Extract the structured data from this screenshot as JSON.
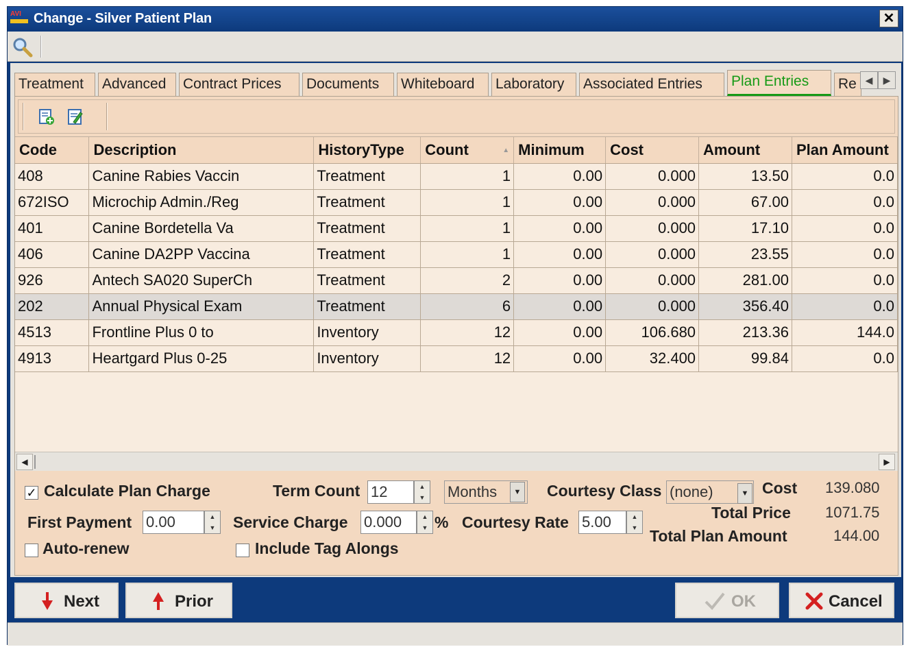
{
  "window": {
    "title": "Change - Silver Patient Plan",
    "logo_text": "AVI",
    "close_glyph": "✕"
  },
  "tabs": [
    {
      "label": "Treatment"
    },
    {
      "label": "Advanced"
    },
    {
      "label": "Contract Prices"
    },
    {
      "label": "Documents"
    },
    {
      "label": "Whiteboard"
    },
    {
      "label": "Laboratory"
    },
    {
      "label": "Associated Entries"
    },
    {
      "label": "Plan Entries",
      "active": true
    },
    {
      "label": "Re"
    }
  ],
  "tab_nav": {
    "left": "◀",
    "right": "▶"
  },
  "grid": {
    "columns": [
      "Code",
      "Description",
      "HistoryType",
      "Count",
      "Minimum",
      "Cost",
      "Amount",
      "Plan Amount"
    ],
    "rows": [
      [
        "408",
        "Canine Rabies Vaccin",
        "Treatment",
        "1",
        "0.00",
        "0.000",
        "13.50",
        "0.0"
      ],
      [
        "672ISO",
        "Microchip Admin./Reg",
        "Treatment",
        "1",
        "0.00",
        "0.000",
        "67.00",
        "0.0"
      ],
      [
        "401",
        "Canine Bordetella Va",
        "Treatment",
        "1",
        "0.00",
        "0.000",
        "17.10",
        "0.0"
      ],
      [
        "406",
        "Canine DA2PP Vaccina",
        "Treatment",
        "1",
        "0.00",
        "0.000",
        "23.55",
        "0.0"
      ],
      [
        "926",
        "Antech SA020 SuperCh",
        "Treatment",
        "2",
        "0.00",
        "0.000",
        "281.00",
        "0.0"
      ],
      [
        "202",
        "Annual Physical Exam",
        "Treatment",
        "6",
        "0.00",
        "0.000",
        "356.40",
        "0.0"
      ],
      [
        "4513",
        "Frontline Plus 0 to",
        "Inventory",
        "12",
        "0.00",
        "106.680",
        "213.36",
        "144.0"
      ],
      [
        "4913",
        "Heartgard Plus 0-25",
        "Inventory",
        "12",
        "0.00",
        "32.400",
        "99.84",
        "0.0"
      ]
    ],
    "selected_row": 5,
    "scroll_left": "◀",
    "scroll_right": "▶"
  },
  "form": {
    "calculate_plan_charge": {
      "label": "Calculate Plan Charge",
      "checked": true,
      "mark": "✓"
    },
    "term_count": {
      "label": "Term Count",
      "value": "12"
    },
    "term_unit": {
      "value": "Months"
    },
    "courtesy_class": {
      "label": "Courtesy Class",
      "value": "(none)"
    },
    "first_payment": {
      "label": "First Payment",
      "value": "0.00"
    },
    "service_charge": {
      "label": "Service Charge",
      "value": "0.000",
      "suffix": "%"
    },
    "courtesy_rate": {
      "label": "Courtesy Rate",
      "value": "5.00"
    },
    "auto_renew": {
      "label": "Auto-renew",
      "checked": false
    },
    "include_tag_alongs": {
      "label": "Include Tag Alongs",
      "checked": false
    },
    "totals": {
      "cost_label": "Cost",
      "cost_value": "139.080",
      "total_price_label": "Total Price",
      "total_price_value": "1071.75",
      "total_plan_amount_label": "Total Plan Amount",
      "total_plan_amount_value": "144.00"
    },
    "spin_up": "▲",
    "spin_down": "▼",
    "dropdown": "▼"
  },
  "buttons": {
    "next": "Next",
    "prior": "Prior",
    "ok": "OK",
    "cancel": "Cancel"
  },
  "colors": {
    "frame": "#0d3a7c",
    "panel": "#f3d9c1",
    "active_tab": "#169a16",
    "arrow_red": "#d42020"
  }
}
